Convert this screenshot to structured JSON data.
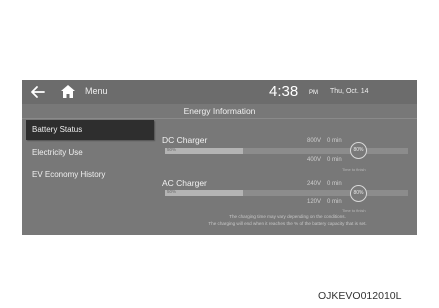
{
  "topbar": {
    "menu_label": "Menu",
    "time": "4:38",
    "ampm": "PM",
    "date": "Thu, Oct. 14"
  },
  "screen_title": "Energy Information",
  "sidebar": {
    "items": [
      {
        "label": "Battery Status",
        "active": true
      },
      {
        "label": "Electricity Use",
        "active": false
      },
      {
        "label": "EV Economy History",
        "active": false
      }
    ]
  },
  "dc_charger": {
    "title": "DC Charger",
    "bar_label": "50%",
    "bar_fill_fraction": 0.32,
    "rows": [
      {
        "voltage": "800V",
        "minutes": "0 min"
      },
      {
        "voltage": "400V",
        "minutes": "0 min"
      }
    ],
    "target_percent": "80%",
    "hint": "Time to finish"
  },
  "ac_charger": {
    "title": "AC Charger",
    "bar_label": "50%",
    "bar_fill_fraction": 0.32,
    "rows": [
      {
        "voltage": "240V",
        "minutes": "0 min"
      },
      {
        "voltage": "120V",
        "minutes": "0 min"
      }
    ],
    "target_percent": "80%",
    "hint": "Time to finish"
  },
  "footnote": {
    "line1": "The charging time may vary depending on the conditions.",
    "line2": "The charging will end when it reaches the % of the battery capacity that is set."
  },
  "caption": "OJKEVO012010L",
  "colors": {
    "screen_bg": "#787878",
    "topbar_bg": "#6c6c6c",
    "active_item_bg": "#2e2e2e",
    "bar_fill": "#b4b4b4",
    "bar_track": "#8c8c8c"
  }
}
